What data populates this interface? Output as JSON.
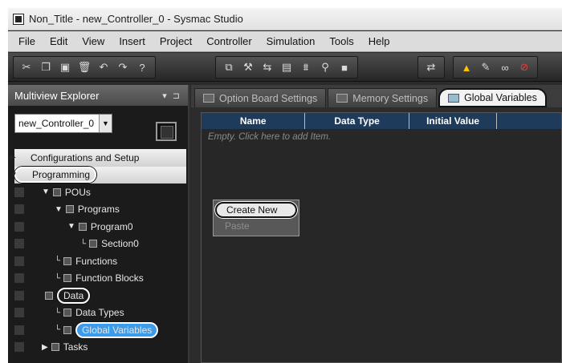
{
  "window": {
    "title": "Non_Title - new_Controller_0 - Sysmac Studio"
  },
  "menu": [
    "File",
    "Edit",
    "View",
    "Insert",
    "Project",
    "Controller",
    "Simulation",
    "Tools",
    "Help"
  ],
  "toolbar": {
    "groups": [
      [
        "cut-icon",
        "copy-icon",
        "paste-icon",
        "delete-icon",
        "undo-icon",
        "redo-icon",
        "help-icon"
      ],
      [
        "window-icon",
        "build-icon",
        "compare-icon",
        "monitor-icon",
        "online-icon",
        "search-icon",
        "stop-icon"
      ],
      [
        "sync-icon"
      ],
      [
        "warning-icon",
        "pen-icon",
        "link-icon",
        "unlink-icon"
      ]
    ],
    "glyphs": {
      "cut-icon": "✂",
      "copy-icon": "❐",
      "paste-icon": "▣",
      "delete-icon": "🗑",
      "undo-icon": "↶",
      "redo-icon": "↷",
      "help-icon": "?",
      "window-icon": "⧉",
      "build-icon": "⚒",
      "compare-icon": "⇆",
      "monitor-icon": "▤",
      "online-icon": "⩩",
      "search-icon": "⚲",
      "stop-icon": "■",
      "sync-icon": "⇄",
      "warning-icon": "▲",
      "pen-icon": "✎",
      "link-icon": "∞",
      "unlink-icon": "⊘"
    }
  },
  "explorer": {
    "title": "Multiview Explorer",
    "controller": "new_Controller_0",
    "tree": [
      {
        "label": "Configurations and Setup",
        "type": "section",
        "level": 0,
        "toggle": "▶",
        "annotated": false,
        "selected": false
      },
      {
        "label": "Programming",
        "type": "section",
        "level": 0,
        "toggle": "▼",
        "annotated": true,
        "selected": false
      },
      {
        "label": "POUs",
        "type": "item",
        "level": 1,
        "toggle": "▼",
        "annotated": false,
        "selected": false
      },
      {
        "label": "Programs",
        "type": "item",
        "level": 2,
        "toggle": "▼",
        "annotated": false,
        "selected": false
      },
      {
        "label": "Program0",
        "type": "item",
        "level": 3,
        "toggle": "▼",
        "annotated": false,
        "selected": false
      },
      {
        "label": "Section0",
        "type": "item",
        "level": 4,
        "toggle": "└",
        "annotated": false,
        "selected": false
      },
      {
        "label": "Functions",
        "type": "item",
        "level": 2,
        "toggle": "└",
        "annotated": false,
        "selected": false
      },
      {
        "label": "Function Blocks",
        "type": "item",
        "level": 2,
        "toggle": "└",
        "annotated": false,
        "selected": false
      },
      {
        "label": "Data",
        "type": "item",
        "level": 1,
        "toggle": "",
        "annotated": true,
        "selected": false
      },
      {
        "label": "Data Types",
        "type": "item",
        "level": 2,
        "toggle": "└",
        "annotated": false,
        "selected": false
      },
      {
        "label": "Global Variables",
        "type": "item",
        "level": 2,
        "toggle": "└",
        "annotated": true,
        "selected": true
      },
      {
        "label": "Tasks",
        "type": "item",
        "level": 1,
        "toggle": "▶",
        "annotated": false,
        "selected": false
      }
    ]
  },
  "editor": {
    "tabs": [
      {
        "label": "Option Board Settings",
        "active": false
      },
      {
        "label": "Memory Settings",
        "active": false
      },
      {
        "label": "Global Variables",
        "active": true
      }
    ],
    "columns": [
      "Name",
      "Data Type",
      "Initial Value"
    ],
    "empty_message": "Empty. Click here to add Item.",
    "context_menu": [
      {
        "label": "Create New",
        "enabled": true
      },
      {
        "label": "Paste",
        "enabled": false
      }
    ]
  }
}
